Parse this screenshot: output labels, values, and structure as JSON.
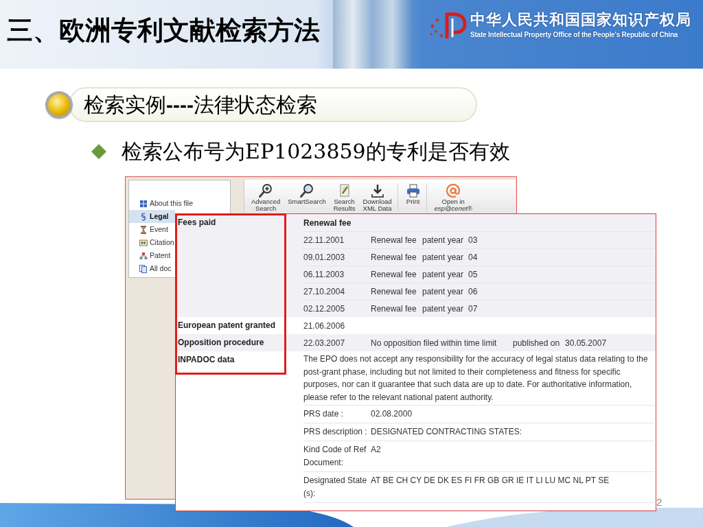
{
  "slide": {
    "title": "三、欧洲专利文献检索方法",
    "logo_name": "中华人民共和国国家知识产权局",
    "logo_subtitle": "State Intellectual Property Office of the People's Republic of China",
    "page_number": "2"
  },
  "section_heading": "检索实例**----**法律状态检索",
  "bullets": [
    "检索公布号为EP1023859的专利是否有效"
  ],
  "screenshot_sidebar": {
    "items": [
      {
        "label": "About this file",
        "selected": false
      },
      {
        "label": "Legal",
        "selected": true
      },
      {
        "label": "Event",
        "selected": false
      },
      {
        "label": "Citation",
        "selected": false
      },
      {
        "label": "Patent",
        "selected": false
      },
      {
        "label": "All doc",
        "selected": false
      }
    ]
  },
  "toolbar": {
    "groups": [
      [
        {
          "lines": [
            "Advanced",
            "Search"
          ]
        },
        {
          "lines": [
            "SmartSearch"
          ]
        },
        {
          "lines": [
            "Search",
            "Results"
          ]
        },
        {
          "lines": [
            "Download",
            "XML Data"
          ]
        }
      ],
      [
        {
          "lines": [
            "Print"
          ]
        }
      ],
      [
        {
          "lines": [
            "Open in",
            "*esp@cenet®*"
          ]
        }
      ]
    ]
  },
  "legal_status": {
    "rows": [
      {
        "label": "Fees paid",
        "kind": "fees",
        "heading": "Renewal fee",
        "entries": [
          {
            "date": "22.11.2001",
            "type": "Renewal fee",
            "year_label": "patent year",
            "year": "03"
          },
          {
            "date": "09.01.2003",
            "type": "Renewal fee",
            "year_label": "patent year",
            "year": "04"
          },
          {
            "date": "06.11.2003",
            "type": "Renewal fee",
            "year_label": "patent year",
            "year": "05"
          },
          {
            "date": "27.10.2004",
            "type": "Renewal fee",
            "year_label": "patent year",
            "year": "06"
          },
          {
            "date": "02.12.2005",
            "type": "Renewal fee",
            "year_label": "patent year",
            "year": "07"
          }
        ]
      },
      {
        "label": "European patent granted",
        "kind": "date",
        "date": "21.06.2006"
      },
      {
        "label": "Opposition procedure",
        "kind": "opposition",
        "date": "22.03.2007",
        "text": "No opposition filed within time limit",
        "published_label": "published on",
        "published_date": "30.05.2007"
      },
      {
        "label": "INPADOC data",
        "kind": "inpadoc",
        "notice": "The EPO does not accept any responsibility for the accuracy of legal status data relating to the post-grant phase, including but not limited to their completeness and fitness for specific purposes, nor can it guarantee that such data are up to date. For authoritative information, please refer to the relevant national patent authority.",
        "fields": [
          {
            "label": "PRS date :",
            "value": "02.08.2000"
          },
          {
            "label": "PRS description :",
            "value": "DESIGNATED CONTRACTING STATES:"
          },
          {
            "label": "Kind Code of Ref Document:",
            "value": "A2"
          },
          {
            "label": "Designated State (s):",
            "value": "AT BE CH CY DE DK ES FI FR GB GR IE IT LI LU MC NL PT SE"
          }
        ]
      }
    ]
  }
}
